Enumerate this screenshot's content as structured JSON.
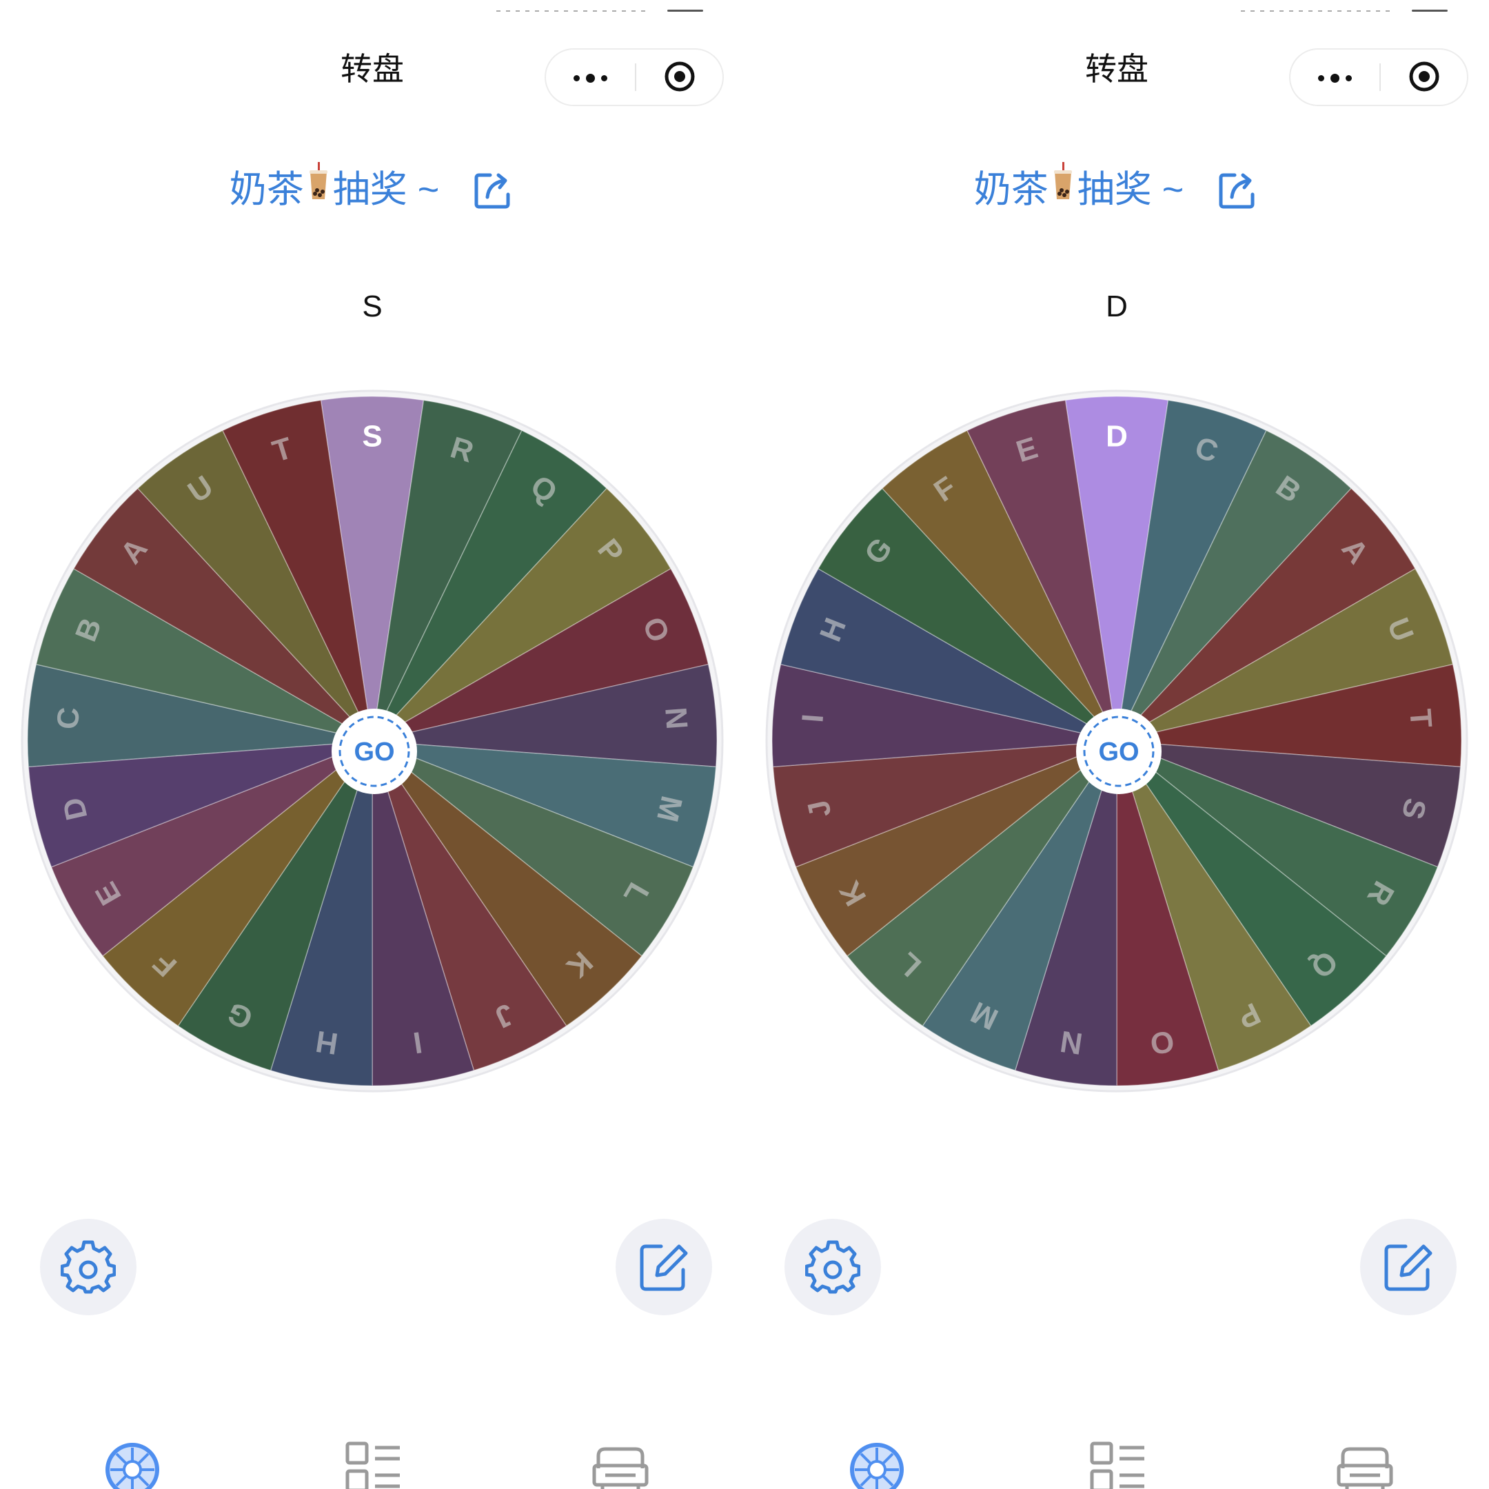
{
  "nav": {
    "title": "转盘"
  },
  "subtitle": {
    "before": "奶茶",
    "after": "抽奖 ~"
  },
  "go_label": "GO",
  "panels": [
    {
      "result": "S",
      "wheel": {
        "selected": "S",
        "segments": [
          {
            "label": "S",
            "color": "#a084b6"
          },
          {
            "label": "R",
            "color": "#3e634c"
          },
          {
            "label": "Q",
            "color": "#386448"
          },
          {
            "label": "P",
            "color": "#77723c"
          },
          {
            "label": "O",
            "color": "#6e2f3c"
          },
          {
            "label": "N",
            "color": "#4f3f5f"
          },
          {
            "label": "M",
            "color": "#4a6d76"
          },
          {
            "label": "L",
            "color": "#4f6d55"
          },
          {
            "label": "K",
            "color": "#74522f"
          },
          {
            "label": "J",
            "color": "#763a40"
          },
          {
            "label": "I",
            "color": "#563a5e"
          },
          {
            "label": "H",
            "color": "#3d4d6c"
          },
          {
            "label": "G",
            "color": "#365e43"
          },
          {
            "label": "F",
            "color": "#77602f"
          },
          {
            "label": "E",
            "color": "#71405a"
          },
          {
            "label": "D",
            "color": "#563f6d"
          },
          {
            "label": "C",
            "color": "#47676e"
          },
          {
            "label": "B",
            "color": "#4e6f58"
          },
          {
            "label": "A",
            "color": "#733a3a"
          },
          {
            "label": "U",
            "color": "#6c6637"
          },
          {
            "label": "T",
            "color": "#702e30"
          }
        ]
      }
    },
    {
      "result": "D",
      "wheel": {
        "selected": "D",
        "segments": [
          {
            "label": "D",
            "color": "#ad8ce2"
          },
          {
            "label": "C",
            "color": "#466a76"
          },
          {
            "label": "B",
            "color": "#4f705d"
          },
          {
            "label": "A",
            "color": "#773938"
          },
          {
            "label": "U",
            "color": "#77713d"
          },
          {
            "label": "T",
            "color": "#732f30"
          },
          {
            "label": "S",
            "color": "#523d56"
          },
          {
            "label": "R",
            "color": "#416a4f"
          },
          {
            "label": "Q",
            "color": "#37674a"
          },
          {
            "label": "P",
            "color": "#7c7843"
          },
          {
            "label": "O",
            "color": "#772f3f"
          },
          {
            "label": "N",
            "color": "#533d62"
          },
          {
            "label": "M",
            "color": "#4a6d76"
          },
          {
            "label": "L",
            "color": "#4e6f55"
          },
          {
            "label": "K",
            "color": "#775432"
          },
          {
            "label": "J",
            "color": "#733a3e"
          },
          {
            "label": "I",
            "color": "#573a5f"
          },
          {
            "label": "H",
            "color": "#3d4b6d"
          },
          {
            "label": "G",
            "color": "#386141"
          },
          {
            "label": "F",
            "color": "#7a6132"
          },
          {
            "label": "E",
            "color": "#734059"
          }
        ]
      }
    }
  ],
  "icons": {
    "more": "more-dots-icon",
    "target": "target-icon",
    "share": "share-icon",
    "boba": "bubble-tea-icon",
    "settings": "gear-icon",
    "edit": "edit-icon",
    "tabs": [
      "wheel-tab-icon",
      "list-tab-icon",
      "sofa-tab-icon"
    ]
  },
  "colors": {
    "accent": "#3a80d9",
    "capsule_border": "#ececec",
    "round_button_bg": "#eff0f5",
    "tab_active": "#4f8ff0",
    "tab_inactive": "#9a9a9a"
  }
}
